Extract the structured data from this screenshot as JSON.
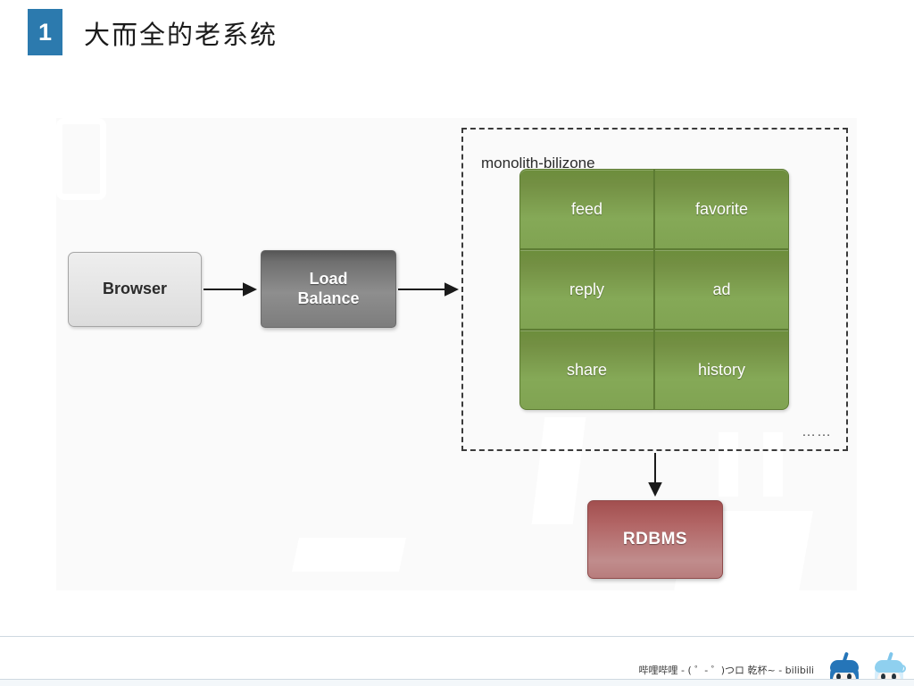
{
  "header": {
    "step_number": "1",
    "title": "大而全的老系统",
    "badge_color": "#2c7aae"
  },
  "diagram": {
    "nodes": [
      {
        "id": "browser",
        "label": "Browser",
        "fill": "#e6e6e6",
        "text_color": "#2b2b2b"
      },
      {
        "id": "load-balance",
        "label_line1": "Load",
        "label_line2": "Balance",
        "fill": "#8e8e8e",
        "text_color": "#ffffff"
      },
      {
        "id": "rdbms",
        "label": "RDBMS",
        "fill": "#b26565",
        "text_color": "#ffffff"
      }
    ],
    "group": {
      "label": "monolith-bilizone",
      "ellipsis": "……",
      "border_style": "dashed",
      "border_color": "#3b3b3b"
    },
    "services": [
      {
        "label": "feed"
      },
      {
        "label": "favorite"
      },
      {
        "label": "reply"
      },
      {
        "label": "ad"
      },
      {
        "label": "share"
      },
      {
        "label": "history"
      }
    ],
    "service_fill": "#7d9f4e",
    "connections": [
      {
        "from": "browser",
        "to": "load-balance",
        "style": "solid-arrow"
      },
      {
        "from": "load-balance",
        "to": "monolith-bilizone",
        "style": "solid-arrow"
      },
      {
        "from": "monolith-bilizone",
        "to": "rdbms",
        "style": "solid-arrow"
      }
    ]
  },
  "footer": {
    "credit": "哔哩哔哩 - ( ゜- ゜)つロ 乾杯~ - bilibili",
    "mascots": [
      "mascot-22",
      "mascot-33"
    ]
  }
}
